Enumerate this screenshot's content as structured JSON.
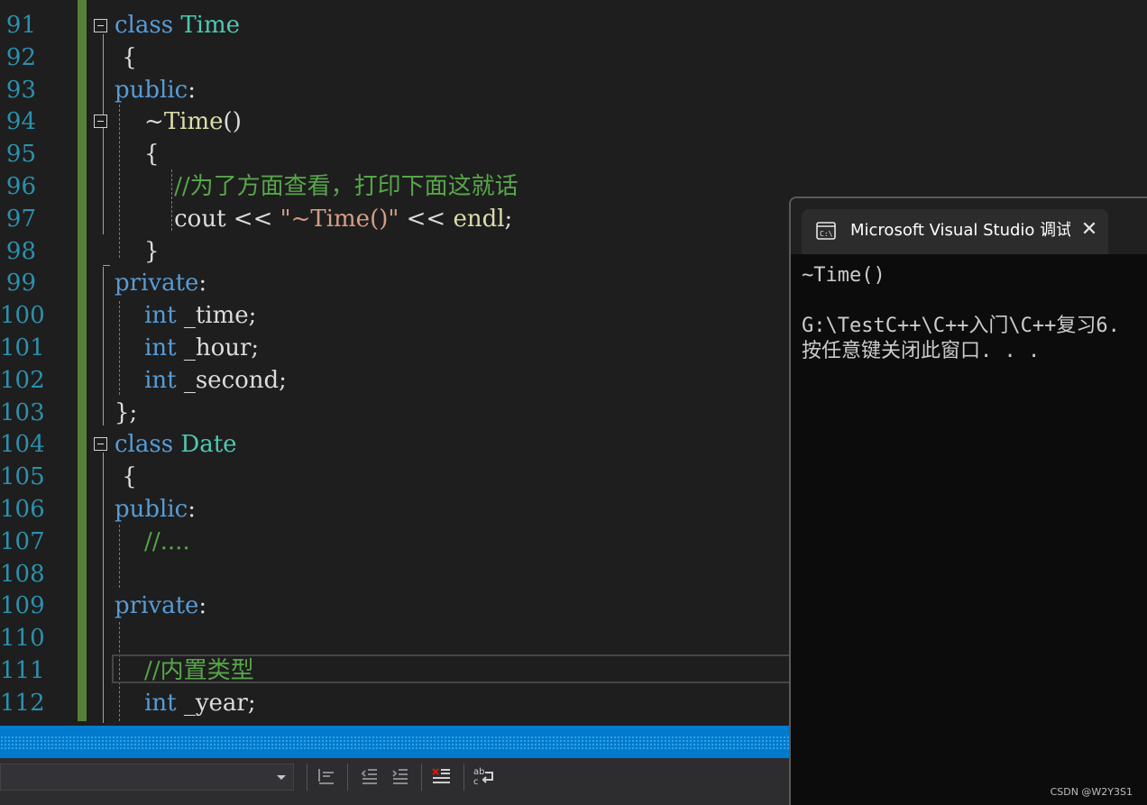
{
  "editor": {
    "lines": [
      {
        "num": "91",
        "tokens": [
          {
            "c": "kw",
            "t": "class"
          },
          {
            "c": "plain",
            "t": " "
          },
          {
            "c": "cls",
            "t": "Time"
          }
        ]
      },
      {
        "num": "92",
        "tokens": [
          {
            "c": "plain",
            "t": " {"
          }
        ]
      },
      {
        "num": "93",
        "tokens": [
          {
            "c": "kw",
            "t": "public"
          },
          {
            "c": "plain",
            "t": ":"
          }
        ]
      },
      {
        "num": "94",
        "tokens": [
          {
            "c": "plain",
            "t": "    ~"
          },
          {
            "c": "fn",
            "t": "Time"
          },
          {
            "c": "plain",
            "t": "()"
          }
        ]
      },
      {
        "num": "95",
        "tokens": [
          {
            "c": "plain",
            "t": "    {"
          }
        ]
      },
      {
        "num": "96",
        "tokens": [
          {
            "c": "cmt",
            "t": "        //为了方面查看，打印下面这就话"
          }
        ]
      },
      {
        "num": "97",
        "tokens": [
          {
            "c": "plain",
            "t": "        cout << "
          },
          {
            "c": "str",
            "t": "\"~Time()\""
          },
          {
            "c": "plain",
            "t": " << "
          },
          {
            "c": "fn",
            "t": "endl"
          },
          {
            "c": "plain",
            "t": ";"
          }
        ]
      },
      {
        "num": "98",
        "tokens": [
          {
            "c": "plain",
            "t": "    }"
          }
        ]
      },
      {
        "num": "99",
        "tokens": [
          {
            "c": "kw",
            "t": "private"
          },
          {
            "c": "plain",
            "t": ":"
          }
        ]
      },
      {
        "num": "100",
        "tokens": [
          {
            "c": "plain",
            "t": "    "
          },
          {
            "c": "kw",
            "t": "int"
          },
          {
            "c": "plain",
            "t": " _time;"
          }
        ]
      },
      {
        "num": "101",
        "tokens": [
          {
            "c": "plain",
            "t": "    "
          },
          {
            "c": "kw",
            "t": "int"
          },
          {
            "c": "plain",
            "t": " _hour;"
          }
        ]
      },
      {
        "num": "102",
        "tokens": [
          {
            "c": "plain",
            "t": "    "
          },
          {
            "c": "kw",
            "t": "int"
          },
          {
            "c": "plain",
            "t": " _second;"
          }
        ]
      },
      {
        "num": "103",
        "tokens": [
          {
            "c": "plain",
            "t": "};"
          }
        ]
      },
      {
        "num": "104",
        "tokens": [
          {
            "c": "kw",
            "t": "class"
          },
          {
            "c": "plain",
            "t": " "
          },
          {
            "c": "cls",
            "t": "Date"
          }
        ]
      },
      {
        "num": "105",
        "tokens": [
          {
            "c": "plain",
            "t": " {"
          }
        ]
      },
      {
        "num": "106",
        "tokens": [
          {
            "c": "kw",
            "t": "public"
          },
          {
            "c": "plain",
            "t": ":"
          }
        ]
      },
      {
        "num": "107",
        "tokens": [
          {
            "c": "cmt",
            "t": "    //...."
          }
        ]
      },
      {
        "num": "108",
        "tokens": []
      },
      {
        "num": "109",
        "tokens": [
          {
            "c": "kw",
            "t": "private"
          },
          {
            "c": "plain",
            "t": ":"
          }
        ]
      },
      {
        "num": "110",
        "tokens": []
      },
      {
        "num": "111",
        "tokens": [
          {
            "c": "cmt",
            "t": "    //内置类型"
          }
        ]
      },
      {
        "num": "112",
        "tokens": [
          {
            "c": "plain",
            "t": "    "
          },
          {
            "c": "kw",
            "t": "int"
          },
          {
            "c": "plain",
            "t": " _year;"
          }
        ]
      }
    ]
  },
  "colors": {
    "keyword": "#569cd6",
    "class_name": "#4ec9b0",
    "function": "#dcdcaa",
    "string": "#d69d85",
    "comment": "#57a64a",
    "line_number": "#2b91af",
    "status_bar": "#007acc"
  },
  "console": {
    "tab_icon": "console-icon",
    "tab_title": "Microsoft Visual Studio 调试控制台",
    "close_label": "✕",
    "output_line1": "~Time()",
    "output_line2": "",
    "output_line3": "G:\\TestC++\\C++入门\\C++复习6.",
    "output_line4": "按任意键关闭此窗口. . ."
  },
  "toolbar": {
    "icons": [
      "outdent-icon",
      "decrease-indent-icon",
      "increase-indent-icon",
      "comment-out-icon",
      "word-wrap-icon"
    ]
  },
  "watermark": "CSDN @W2Y3S1"
}
